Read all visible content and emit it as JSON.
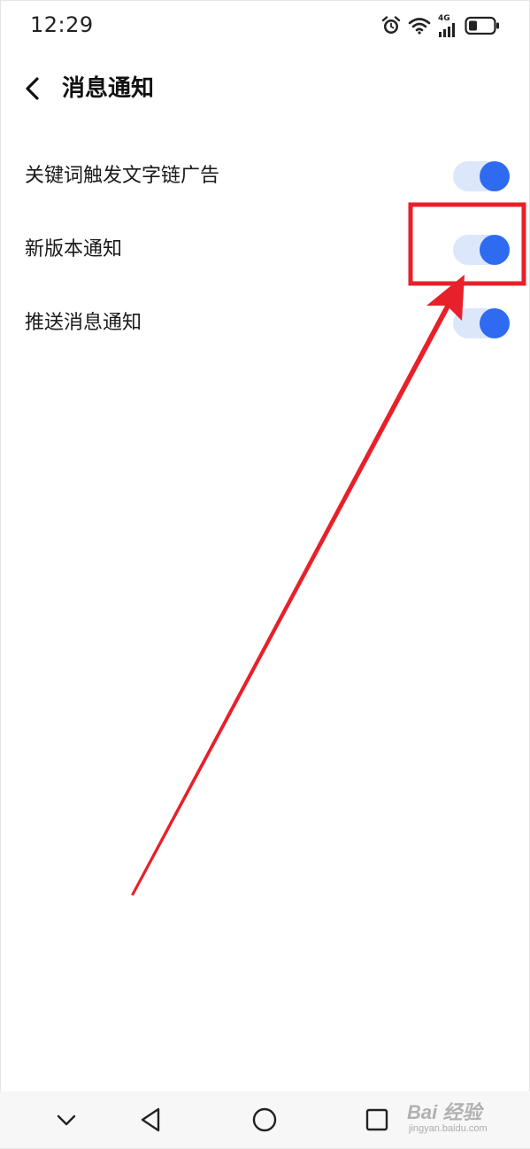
{
  "status_bar": {
    "time": "12:29",
    "network_label": "4G",
    "icons": [
      "alarm-icon",
      "wifi-icon",
      "cellular-signal-icon",
      "battery-icon"
    ]
  },
  "header": {
    "back_icon": "chevron-left-icon",
    "title": "消息通知"
  },
  "settings": [
    {
      "label": "关键词触发文字链广告",
      "enabled": true
    },
    {
      "label": "新版本通知",
      "enabled": true
    },
    {
      "label": "推送消息通知",
      "enabled": true
    }
  ],
  "annotation": {
    "highlighted_setting": "新版本通知",
    "color": "#e8202a"
  },
  "nav_bar": {
    "buttons": [
      "chevron-down-icon",
      "back-triangle-icon",
      "home-circle-icon",
      "recents-square-icon"
    ]
  },
  "watermark": {
    "main": "Bai 经验",
    "sub": "jingyan.baidu.com"
  },
  "colors": {
    "accent": "#2e6bf0",
    "toggle_track": "#dde7fb",
    "annotation": "#e8202a"
  }
}
